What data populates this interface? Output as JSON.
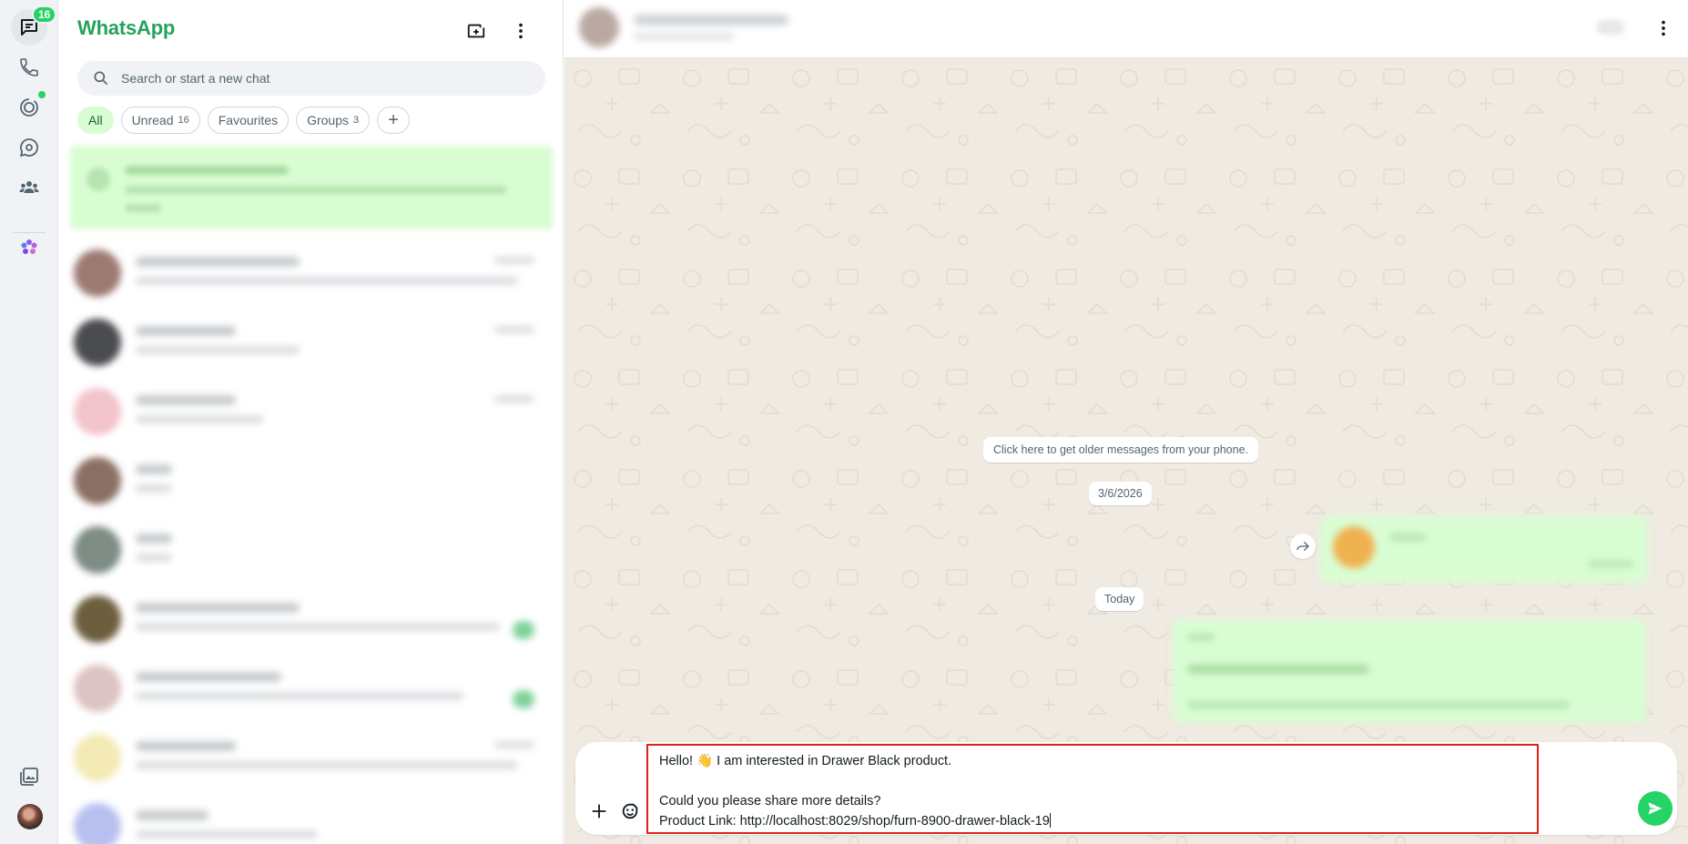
{
  "rail": {
    "chats_badge": "16",
    "items": [
      {
        "name": "chats-icon",
        "icon": "chats"
      },
      {
        "name": "calls-icon",
        "icon": "phone"
      },
      {
        "name": "status-icon",
        "icon": "status"
      },
      {
        "name": "channels-icon",
        "icon": "channels"
      },
      {
        "name": "communities-icon",
        "icon": "communities"
      },
      {
        "name": "meta-ai-icon",
        "icon": "meta-ai"
      }
    ],
    "bottom": [
      {
        "name": "media-icon",
        "icon": "media"
      },
      {
        "name": "profile-avatar",
        "icon": "avatar"
      }
    ]
  },
  "sidebar": {
    "brand": "WhatsApp",
    "search_placeholder": "Search or start a new chat",
    "filters": [
      {
        "label": "All",
        "count": "",
        "active": true
      },
      {
        "label": "Unread",
        "count": "16",
        "active": false
      },
      {
        "label": "Favourites",
        "count": "",
        "active": false
      },
      {
        "label": "Groups",
        "count": "3",
        "active": false
      }
    ]
  },
  "conversation": {
    "older_messages_hint": "Click here to get older messages from your phone.",
    "date_1": "3/6/2026",
    "date_2": "Today",
    "composer": {
      "text_line_1": "Hello! 👋 I am interested in Drawer Black product.",
      "text_line_2": "",
      "text_line_3": "Could you please share more details?",
      "text_line_4": "Product Link: http://localhost:8029/shop/furn-8900-drawer-black-19"
    }
  },
  "colors": {
    "brand_green": "#25a25a",
    "accent_green": "#25d366",
    "bubble_out": "#d9fdd3",
    "chat_background": "#efeae2",
    "highlight_border": "#e0201a"
  }
}
